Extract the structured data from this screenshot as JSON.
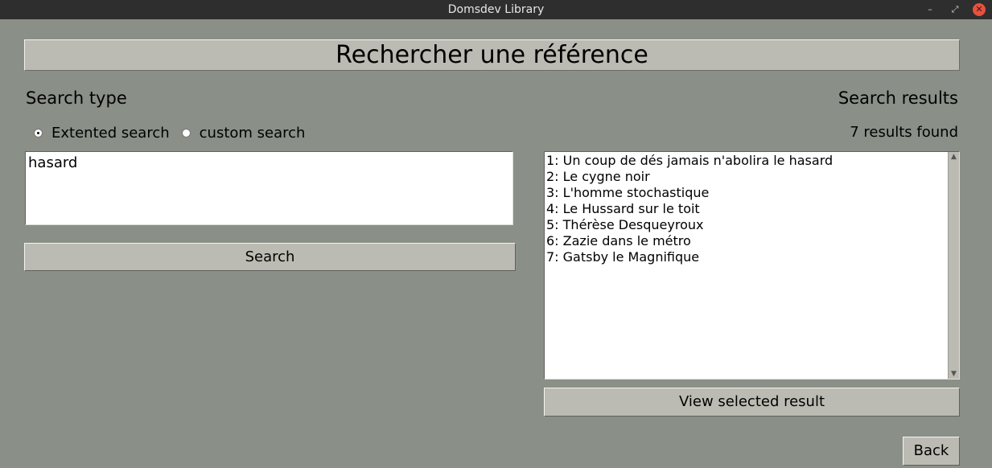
{
  "window": {
    "title": "Domsdev Library",
    "controls": {
      "minimize": "–",
      "maximize": "⤢",
      "close": "✕"
    }
  },
  "header": {
    "title": "Rechercher une référence"
  },
  "left": {
    "section_label": "Search type",
    "radios": [
      {
        "label": "Extented search",
        "selected": true
      },
      {
        "label": "custom search",
        "selected": false
      }
    ],
    "query_text": "hasard",
    "search_button": "Search"
  },
  "right": {
    "section_label": "Search results",
    "count_text": "7 results found",
    "results": [
      "1: Un coup de dés jamais n'abolira le hasard",
      "2: Le cygne noir",
      "3: L'homme stochastique",
      "4: Le Hussard sur le toit",
      "5: Thérèse Desqueyroux",
      "6: Zazie dans le métro",
      "7: Gatsby le Magnifique"
    ],
    "scroll_up": "▲",
    "scroll_down": "▼",
    "view_button": "View selected result"
  },
  "footer": {
    "back_button": "Back"
  }
}
